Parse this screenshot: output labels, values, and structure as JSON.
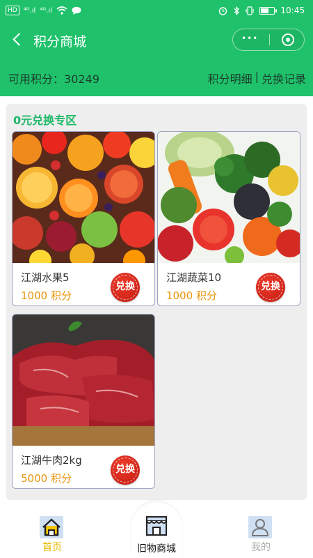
{
  "status_bar": {
    "hd": "HD",
    "sig1": "⁴ᴳ.ıl",
    "sig2": "⁴ᴳ.ıl",
    "time": "10:45",
    "icons": [
      "alarm-icon",
      "bluetooth-icon",
      "vibrate-icon",
      "battery-icon",
      "wifi-icon",
      "message-icon"
    ]
  },
  "nav": {
    "title": "积分商城",
    "back_icon": "chevron-left-icon",
    "more_icon": "more-dots-icon",
    "close_icon": "target-close-icon"
  },
  "points": {
    "label": "可用积分：",
    "value": "30249",
    "detail_link": "积分明细",
    "divider": "|",
    "history_link": "兑换记录"
  },
  "zone": {
    "title": "0元兑换专区"
  },
  "products": [
    {
      "name": "江湖水果5",
      "points": "1000",
      "unit": "积分",
      "redeem_label": "兑换",
      "image": "fruit-photo"
    },
    {
      "name": "江湖蔬菜10",
      "points": "1000",
      "unit": "积分",
      "redeem_label": "兑换",
      "image": "vegetable-photo"
    },
    {
      "name": "江湖牛肉2kg",
      "points": "5000",
      "unit": "积分",
      "redeem_label": "兑换",
      "image": "beef-photo"
    }
  ],
  "tabbar": {
    "tabs": [
      {
        "label": "首页",
        "icon": "home-icon",
        "color": "#e6b800"
      },
      {
        "label": "旧物商城",
        "icon": "shop-icon",
        "color": "#111111"
      },
      {
        "label": "我的",
        "icon": "user-icon",
        "color": "#aaaaaa"
      }
    ]
  },
  "colors": {
    "brand_green": "#1fc26b",
    "price_orange": "#e8940c",
    "redeem_red": "#d4241a"
  }
}
